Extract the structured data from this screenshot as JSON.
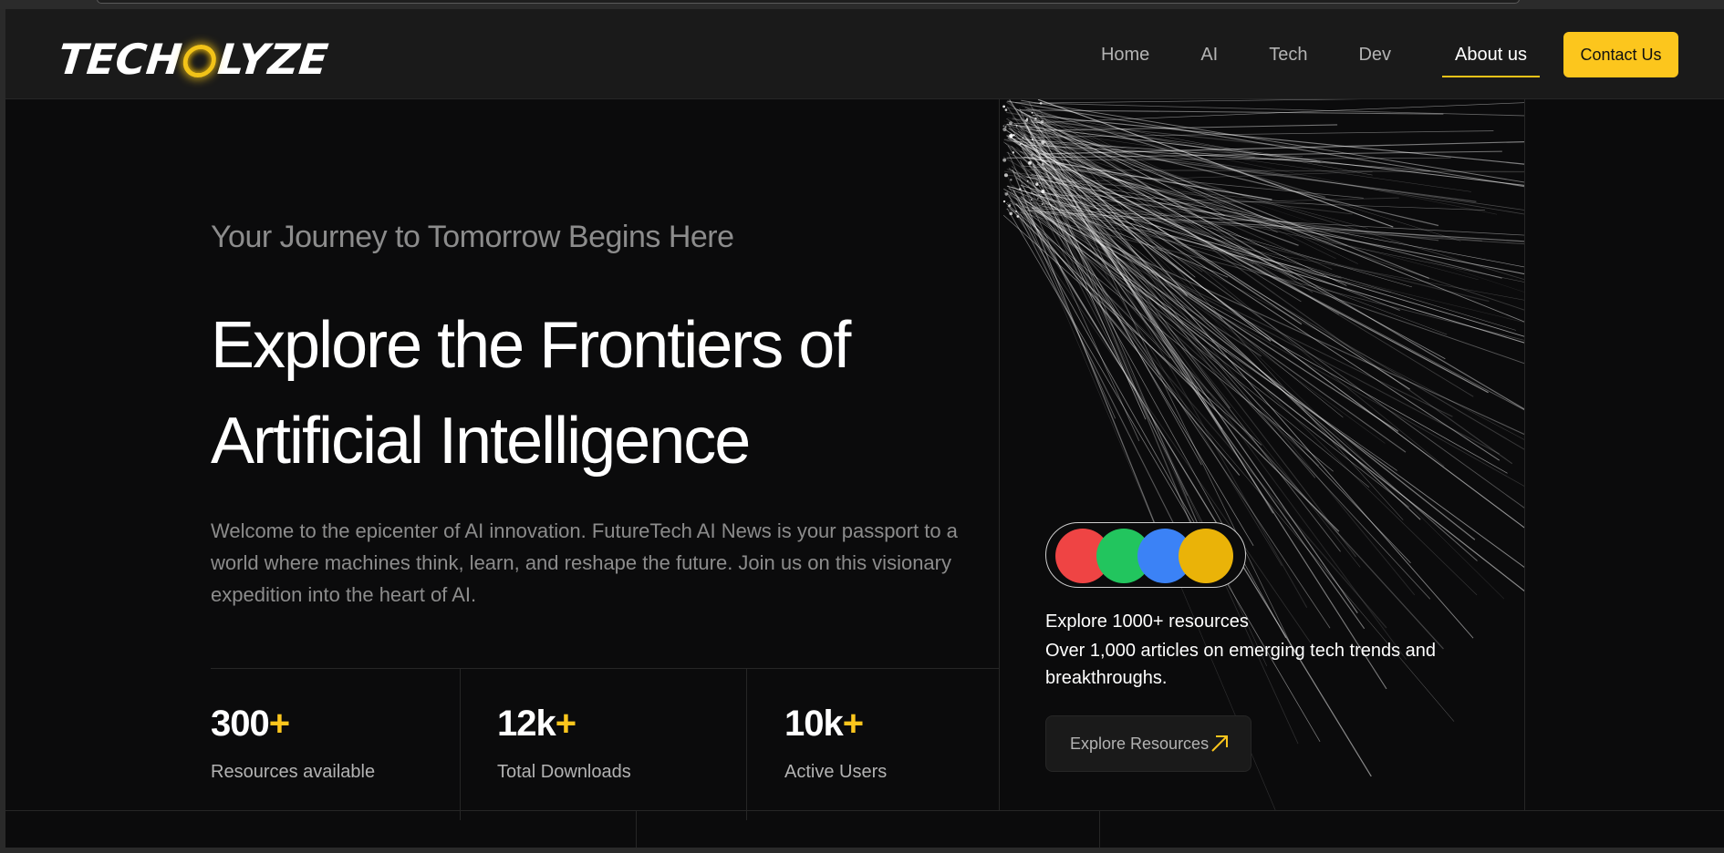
{
  "header": {
    "logo_text_before": "TECH",
    "logo_text_after": "LYZE",
    "nav": [
      {
        "label": "Home"
      },
      {
        "label": "AI"
      },
      {
        "label": "Tech"
      },
      {
        "label": "Dev"
      },
      {
        "label": "About us",
        "active": true
      }
    ],
    "contact_label": "Contact Us"
  },
  "hero": {
    "tagline": "Your Journey to Tomorrow Begins Here",
    "headline_line1": "Explore the Frontiers of",
    "headline_line2": "Artificial Intelligence",
    "intro": "Welcome to the epicenter of AI innovation. FutureTech AI News is your passport to a world where machines think, learn, and reshape the future. Join us on this visionary expedition into the heart of AI."
  },
  "stats": [
    {
      "value": "300",
      "suffix": "+",
      "label": "Resources available"
    },
    {
      "value": "12k",
      "suffix": "+",
      "label": "Total Downloads"
    },
    {
      "value": "10k",
      "suffix": "+",
      "label": "Active Users"
    }
  ],
  "resources": {
    "avatar_colors": [
      "#ef4444",
      "#22c55e",
      "#3b82f6",
      "#eab308"
    ],
    "title": "Explore 1000+ resources",
    "description": "Over 1,000 articles on emerging tech trends and breakthroughs.",
    "button_label": "Explore Resources"
  },
  "colors": {
    "accent": "#fcc61d",
    "background": "#0b0b0c",
    "header_bg": "#1a1a1a"
  }
}
